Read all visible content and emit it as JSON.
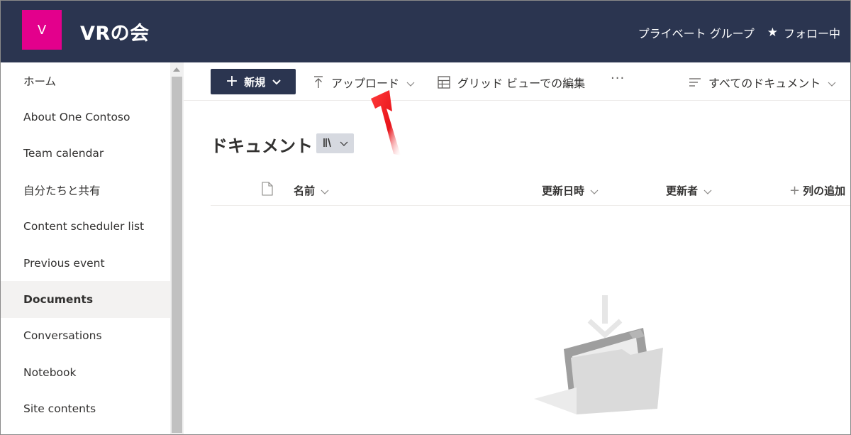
{
  "header": {
    "logo_letter": "V",
    "site_title": "VRの会",
    "privacy": "プライベート グループ",
    "follow": "フォロー中"
  },
  "sidebar": {
    "items": [
      {
        "label": "ホーム",
        "active": false
      },
      {
        "label": "About One Contoso",
        "active": false
      },
      {
        "label": "Team calendar",
        "active": false
      },
      {
        "label": "自分たちと共有",
        "active": false
      },
      {
        "label": "Content scheduler list",
        "active": false
      },
      {
        "label": "Previous event",
        "active": false
      },
      {
        "label": "Documents",
        "active": true
      },
      {
        "label": "Conversations",
        "active": false
      },
      {
        "label": "Notebook",
        "active": false
      },
      {
        "label": "Site contents",
        "active": false
      }
    ]
  },
  "toolbar": {
    "new_label": "新規",
    "upload_label": "アップロード",
    "grid_edit_label": "グリッド ビューでの編集",
    "more_label": "···",
    "view_label": "すべてのドキュメント"
  },
  "library": {
    "title": "ドキュメント",
    "columns": {
      "name": "名前",
      "modified": "更新日時",
      "modified_by": "更新者",
      "add_column": "列の追加"
    }
  },
  "colors": {
    "header_bg": "#2b3550",
    "logo_bg": "#e3008c",
    "annotation_red": "#e8131a"
  }
}
